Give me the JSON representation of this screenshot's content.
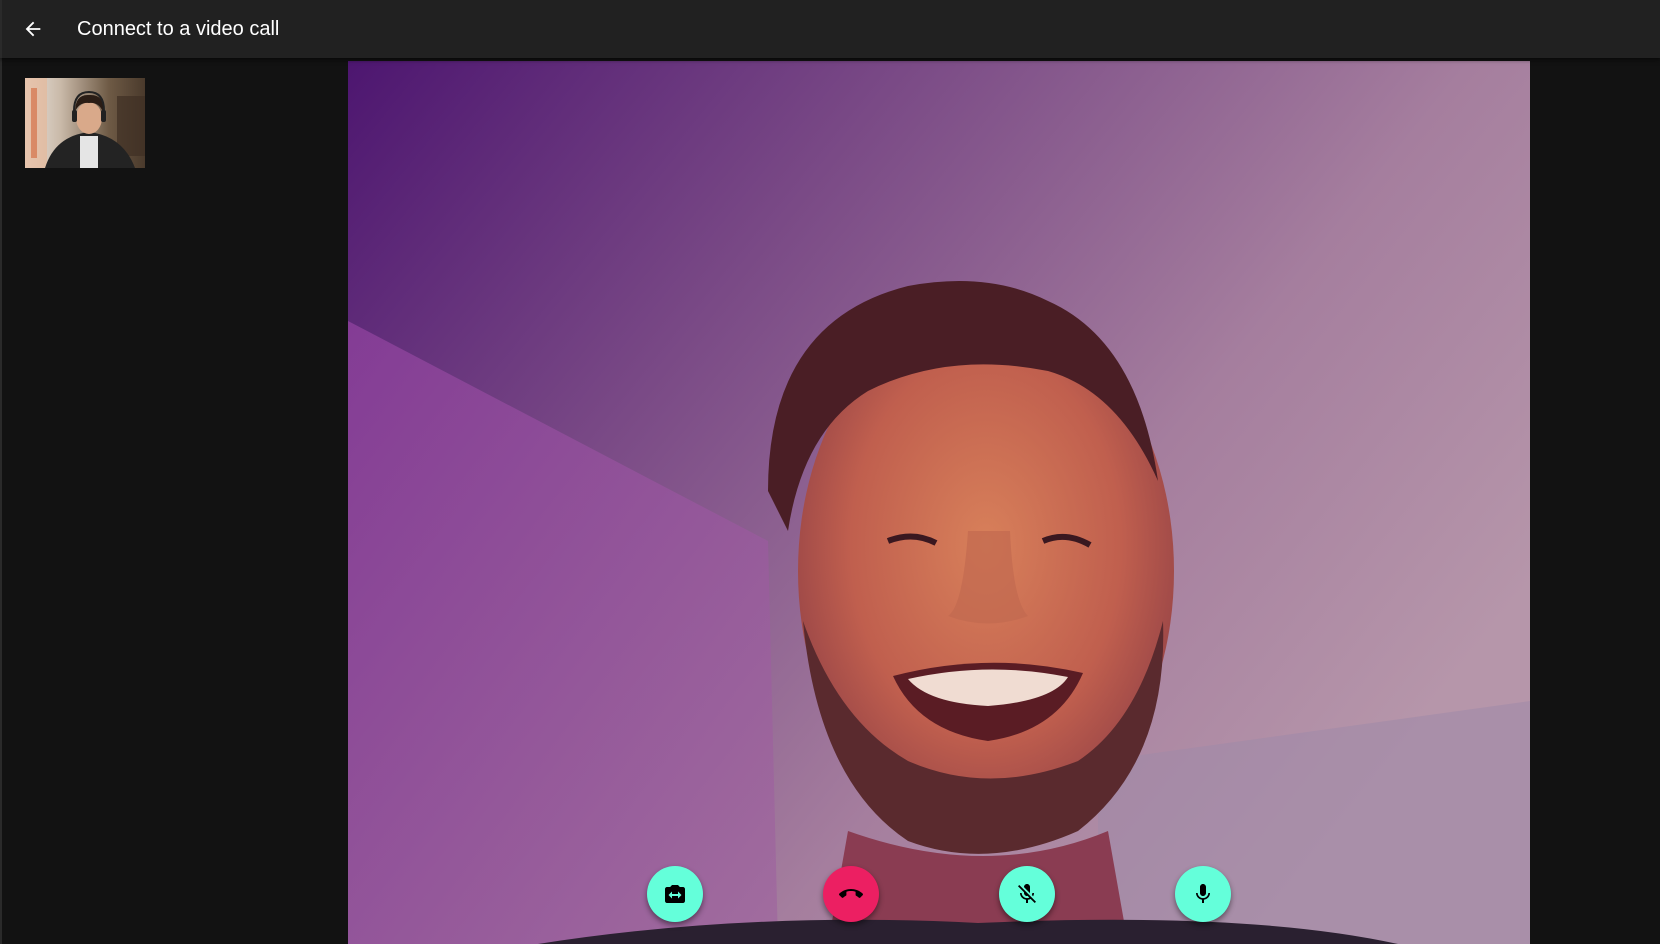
{
  "app_bar": {
    "back_icon": "arrow-back-icon",
    "title": "Connect to a video call"
  },
  "self_view": {
    "icon": "local-camera-preview"
  },
  "remote_video": {
    "icon": "remote-participant-video"
  },
  "controls": [
    {
      "name": "switch-camera-button",
      "icon": "switch-camera-icon",
      "color": "#64ffda"
    },
    {
      "name": "hang-up-button",
      "icon": "call-end-icon",
      "color": "#ec1f62"
    },
    {
      "name": "mute-remote-button",
      "icon": "mic-off-icon",
      "color": "#64ffda"
    },
    {
      "name": "microphone-button",
      "icon": "mic-icon",
      "color": "#64ffda"
    }
  ]
}
